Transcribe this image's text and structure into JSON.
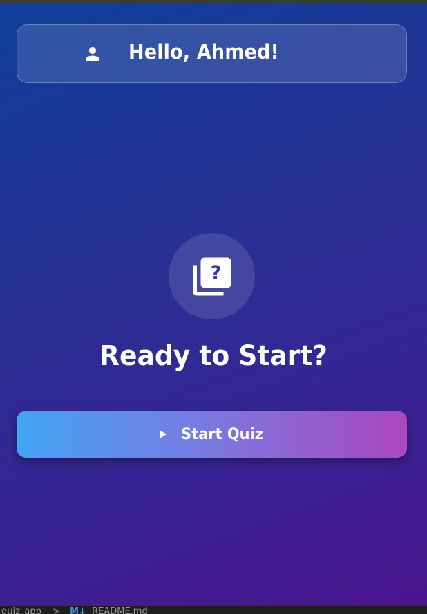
{
  "greeting": {
    "text": "Hello, Ahmed!",
    "icon": "person-icon"
  },
  "quiz_icon": "quiz-icon",
  "title": "Ready to Start?",
  "start_button": {
    "label": "Start Quiz",
    "icon": "play-arrow-icon"
  },
  "status_bar": {
    "path": "quiz_app",
    "separator": ">",
    "file_badge": "M↓",
    "file": "README.md"
  },
  "colors": {
    "background_start": "#0f3f9a",
    "background_end": "#4a148c",
    "button_start": "#42a5f5",
    "button_end": "#ab47bc",
    "text": "#ffffff"
  }
}
